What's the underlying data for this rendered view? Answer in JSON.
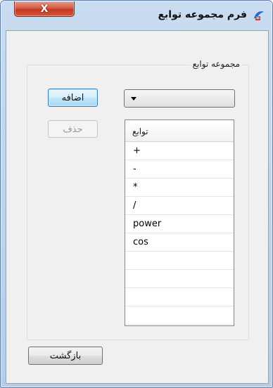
{
  "window": {
    "title": "فرم مجموعه توابع",
    "close_label": "X"
  },
  "group": {
    "label": "مجموعه توابع"
  },
  "combo": {
    "value": ""
  },
  "buttons": {
    "add_label": "اضافه",
    "delete_label": "حذف",
    "back_label": "بازگشت"
  },
  "grid": {
    "header": "توابع",
    "rows": [
      "+",
      "-",
      "*",
      "/",
      "power",
      "cos",
      "",
      "",
      "",
      "",
      ""
    ]
  },
  "colors": {
    "title_gradient": "#c9dcf0",
    "close_button": "#c53a22",
    "default_button_border": "#3c7fb1",
    "disabled_text": "#9a9a9a"
  },
  "icons": {
    "title": "function-set-icon",
    "combo": "chevron-down-icon",
    "close": "close-icon"
  }
}
